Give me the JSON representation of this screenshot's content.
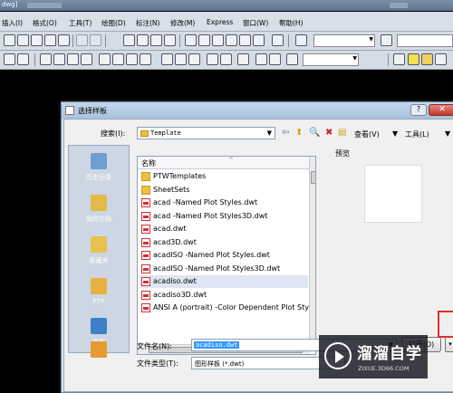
{
  "window": {
    "title_fragment": "dwg]"
  },
  "menu": {
    "items": [
      "插入(I)",
      "格式(O)",
      "工具(T)",
      "绘图(D)",
      "标注(N)",
      "修改(M)",
      "Express",
      "窗口(W)",
      "帮助(H)"
    ]
  },
  "dialog": {
    "title": "选择样板",
    "help_label": "?",
    "close_label": "✕",
    "search_in_label": "搜索(I):",
    "search_in_value": "Template",
    "views_label": "查看(V)",
    "tools_label": "工具(L)",
    "preview_label": "预览",
    "column_name": "名称",
    "places": [
      "历史记录",
      "我的文档",
      "收藏夹",
      "FTP",
      "桌面"
    ],
    "files": [
      {
        "name": "PTWTemplates",
        "type": "folder"
      },
      {
        "name": "SheetSets",
        "type": "folder"
      },
      {
        "name": "acad -Named Plot Styles.dwt",
        "type": "dwt"
      },
      {
        "name": "acad -Named Plot Styles3D.dwt",
        "type": "dwt"
      },
      {
        "name": "acad.dwt",
        "type": "dwt"
      },
      {
        "name": "acad3D.dwt",
        "type": "dwt"
      },
      {
        "name": "acadISO -Named Plot Styles.dwt",
        "type": "dwt"
      },
      {
        "name": "acadISO -Named Plot Styles3D.dwt",
        "type": "dwt"
      },
      {
        "name": "acadiso.dwt",
        "type": "dwt",
        "selected": true
      },
      {
        "name": "acadiso3D.dwt",
        "type": "dwt"
      },
      {
        "name": "ANSI A (portrait) -Color Dependent Plot Style",
        "type": "dwt"
      }
    ],
    "filename_label": "文件名(N):",
    "filename_value": "acadiso.dwt",
    "filetype_label": "文件类型(T):",
    "filetype_value": "图形样板 (*.dwt)",
    "open_label": "打开(O)",
    "dropdown_arrow": "▾"
  },
  "watermark": {
    "cn": "溜溜自学",
    "en": "ZIXUE.3D66.COM"
  },
  "colors": {
    "highlight": "#e03030",
    "selection": "#3399ff",
    "dialog_bg": "#d6e2ef"
  }
}
